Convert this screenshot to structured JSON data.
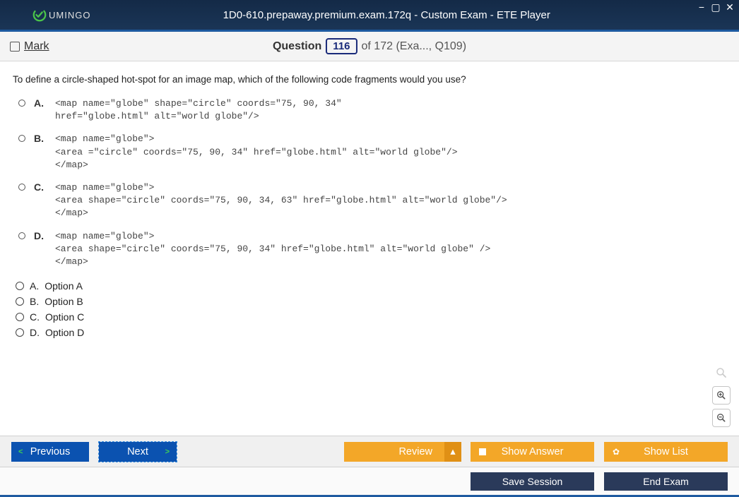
{
  "window": {
    "logo_text": "UMINGO",
    "title": "1D0-610.prepaway.premium.exam.172q - Custom Exam - ETE Player"
  },
  "subheader": {
    "mark_label": "Mark",
    "question_word": "Question",
    "question_number": "116",
    "question_rest": "of 172 (Exa..., Q109)"
  },
  "question": {
    "text": "To define a circle-shaped hot-spot for an image map, which of the following code fragments would you use?",
    "code_options": [
      {
        "letter": "A.",
        "code": "<map name=\"globe\" shape=\"circle\" coords=\"75, 90, 34\"\nhref=\"globe.html\" alt=\"world globe\"/>"
      },
      {
        "letter": "B.",
        "code": "<map name=\"globe\">\n<area =\"circle\" coords=\"75, 90, 34\" href=\"globe.html\" alt=\"world globe\"/>\n</map>"
      },
      {
        "letter": "C.",
        "code": "<map name=\"globe\">\n<area shape=\"circle\" coords=\"75, 90, 34, 63\" href=\"globe.html\" alt=\"world globe\"/>\n</map>"
      },
      {
        "letter": "D.",
        "code": "<map name=\"globe\">\n<area shape=\"circle\" coords=\"75, 90, 34\" href=\"globe.html\" alt=\"world globe\" />\n</map>"
      }
    ],
    "answer_options": [
      {
        "letter": "A.",
        "label": "Option A"
      },
      {
        "letter": "B.",
        "label": "Option B"
      },
      {
        "letter": "C.",
        "label": "Option C"
      },
      {
        "letter": "D.",
        "label": "Option D"
      }
    ]
  },
  "footer": {
    "previous": "Previous",
    "next": "Next",
    "review": "Review",
    "show_answer": "Show Answer",
    "show_list": "Show List",
    "save_session": "Save Session",
    "end_exam": "End Exam"
  }
}
